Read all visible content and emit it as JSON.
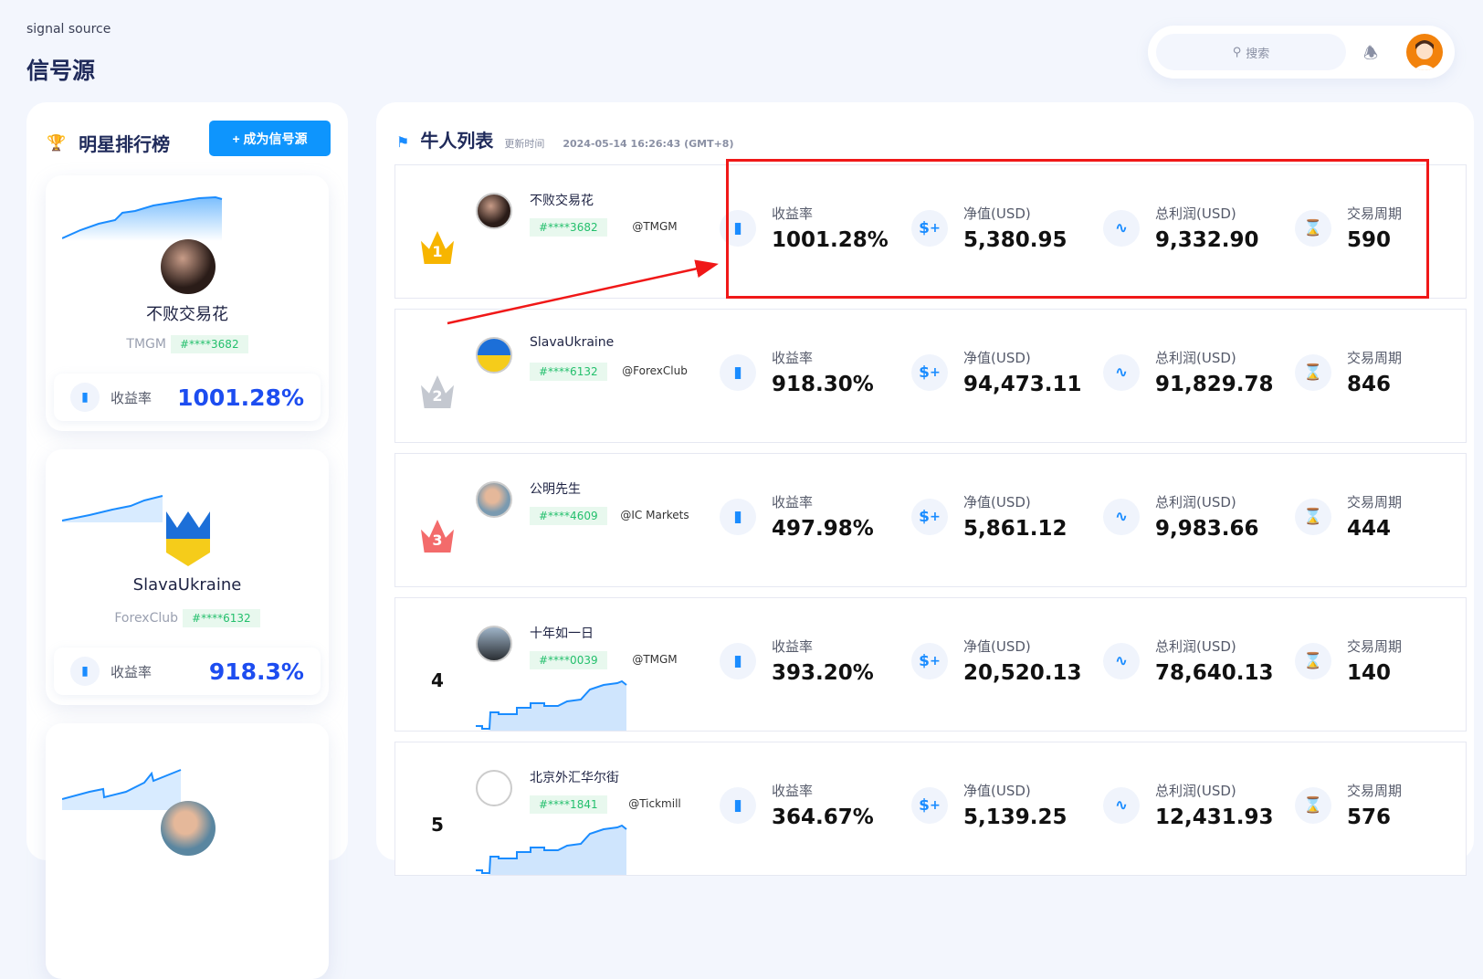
{
  "header": {
    "subtitle": "signal source",
    "title": "信号源",
    "search_placeholder": "搜索"
  },
  "left": {
    "title": "明星排行榜",
    "become_button": "+ 成为信号源",
    "stars": [
      {
        "name": "不败交易花",
        "broker": "TMGM",
        "account": "#****3682",
        "stat_label": "收益率",
        "stat_value": "1001.28%"
      },
      {
        "name": "SlavaUkraine",
        "broker": "ForexClub",
        "account": "#****6132",
        "stat_label": "收益率",
        "stat_value": "918.3%"
      }
    ]
  },
  "list": {
    "title": "牛人列表",
    "updated_label": "更新时间",
    "updated_time": "2024-05-14 16:26:43 (GMT+8)",
    "stat_labels": [
      "收益率",
      "净值(USD)",
      "总利润(USD)",
      "交易周期"
    ],
    "rows": [
      {
        "rank": "1",
        "name": "不败交易花",
        "account": "#****3682",
        "broker": "@TMGM",
        "return": "1001.28%",
        "equity": "5,380.95",
        "profit": "9,332.90",
        "period": "590"
      },
      {
        "rank": "2",
        "name": "SlavaUkraine",
        "account": "#****6132",
        "broker": "@ForexClub",
        "return": "918.30%",
        "equity": "94,473.11",
        "profit": "91,829.78",
        "period": "846"
      },
      {
        "rank": "3",
        "name": "公明先生",
        "account": "#****4609",
        "broker": "@IC Markets",
        "return": "497.98%",
        "equity": "5,861.12",
        "profit": "9,983.66",
        "period": "444"
      },
      {
        "rank": "4",
        "name": "十年如一日",
        "account": "#****0039",
        "broker": "@TMGM",
        "return": "393.20%",
        "equity": "20,520.13",
        "profit": "78,640.13",
        "period": "140"
      },
      {
        "rank": "5",
        "name": "北京外汇华尔街",
        "account": "#****1841",
        "broker": "@Tickmill",
        "return": "364.67%",
        "equity": "5,139.25",
        "profit": "12,431.93",
        "period": "576"
      }
    ]
  },
  "colors": {
    "accent": "#0e95fd",
    "value_blue": "#1d4df0",
    "tag_green": "#23bf6c",
    "highlight": "#f01818"
  }
}
